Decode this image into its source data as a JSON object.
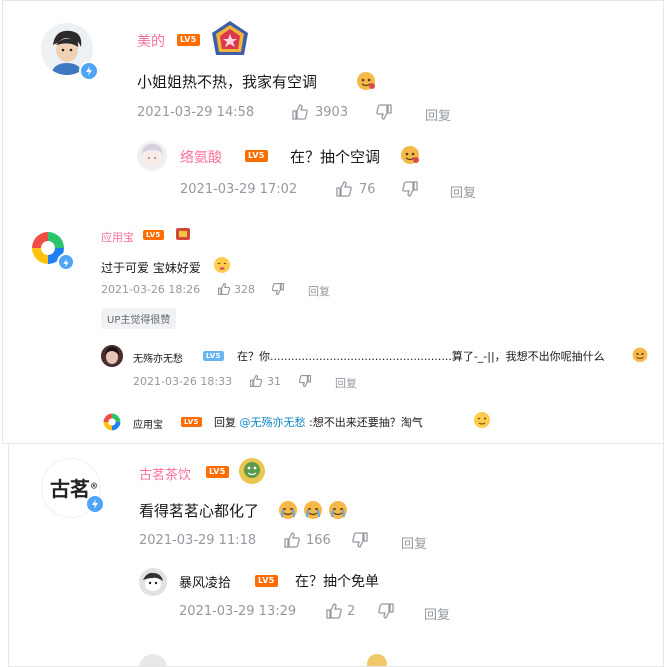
{
  "colors": {
    "pink_name": "#fb7299",
    "level_orange": "#ff6c00",
    "level_blue": "#68b6ef",
    "meta_gray": "#9499a0",
    "mention_blue": "#0c85c7"
  },
  "comment1": {
    "username": "美的",
    "level": "LV5",
    "text": "小姐姐热不热，我家有空调",
    "time": "2021-03-29 14:58",
    "likes": "3903",
    "reply_label": "回复",
    "reply": {
      "username": "络氨酸",
      "level": "LV5",
      "text": "在？抽个空调",
      "time": "2021-03-29 17:02",
      "likes": "76",
      "reply_label": "回复"
    }
  },
  "comment2": {
    "username": "应用宝",
    "level": "LV5",
    "text": "过于可爱 宝妹好爱",
    "time": "2021-03-26 18:26",
    "likes": "328",
    "reply_label": "回复",
    "up_tag": "UP主觉得很赞",
    "reply1": {
      "username": "无殇亦无愁",
      "level": "LV5",
      "text": "在？你....................................................算了-_-||，我想不出你呢抽什么",
      "time": "2021-03-26 18:33",
      "likes": "31",
      "reply_label": "回复"
    },
    "reply2": {
      "username": "应用宝",
      "level": "LV5",
      "prefix": "回复",
      "mention": "@无殇亦无愁",
      "text": ":想不出来还要抽？淘气"
    }
  },
  "comment3": {
    "username": "古茗茶饮",
    "level": "LV5",
    "avatar_text": "古茗",
    "avatar_mark": "®",
    "text": "看得茗茗心都化了",
    "time": "2021-03-29 11:18",
    "likes": "166",
    "reply_label": "回复",
    "reply": {
      "username": "暴风凌拾",
      "level": "LV5",
      "text": "在？抽个免单",
      "time": "2021-03-29 13:29",
      "likes": "2",
      "reply_label": "回复"
    }
  },
  "icons": [
    "thumb-up-icon",
    "thumb-down-icon",
    "verified-icon",
    "emoji-icon",
    "pendant-badge-icon"
  ]
}
